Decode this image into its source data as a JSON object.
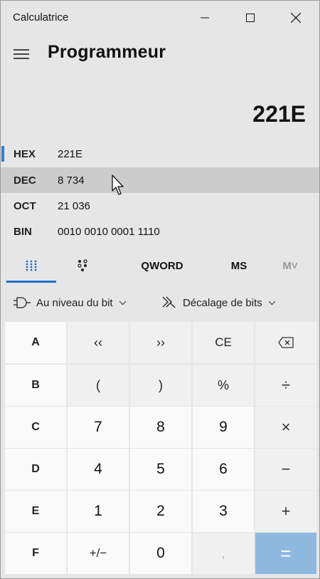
{
  "window": {
    "title": "Calculatrice",
    "controls": [
      "minimize-icon",
      "maximize-icon",
      "close-icon"
    ]
  },
  "header": {
    "menu_icon": "hamburger-menu-icon",
    "mode": "Programmeur"
  },
  "display": {
    "value": "221E"
  },
  "radix": [
    {
      "label": "HEX",
      "value": "221E",
      "selected": true
    },
    {
      "label": "DEC",
      "value": "8 734",
      "hovered": true
    },
    {
      "label": "OCT",
      "value": "21 036"
    },
    {
      "label": "BIN",
      "value": "0010 0010 0001 1110"
    }
  ],
  "tabs": {
    "keypad_icon": "full-keypad-icon",
    "bit_toggle_icon": "bit-toggle-keypad-icon",
    "word_size": "QWORD",
    "memory_store": "MS",
    "memory_recall": "M˅"
  },
  "bitwise": {
    "bitwise_label": "Au niveau du bit",
    "bitshift_label": "Décalage de bits"
  },
  "keys": {
    "row1": [
      "A",
      "‹‹",
      "››",
      "CE",
      "backspace-icon"
    ],
    "row2": [
      "B",
      "(",
      ")",
      "%",
      "÷"
    ],
    "row3": [
      "C",
      "7",
      "8",
      "9",
      "×"
    ],
    "row4": [
      "D",
      "4",
      "5",
      "6",
      "−"
    ],
    "row5": [
      "E",
      "1",
      "2",
      "3",
      "+"
    ],
    "row6": [
      "F",
      "+/−",
      "0",
      ",",
      "="
    ]
  },
  "colors": {
    "accent": "#2b7fd9",
    "equals_bg": "#8fb8e0",
    "window_bg": "#e6e6e6"
  }
}
